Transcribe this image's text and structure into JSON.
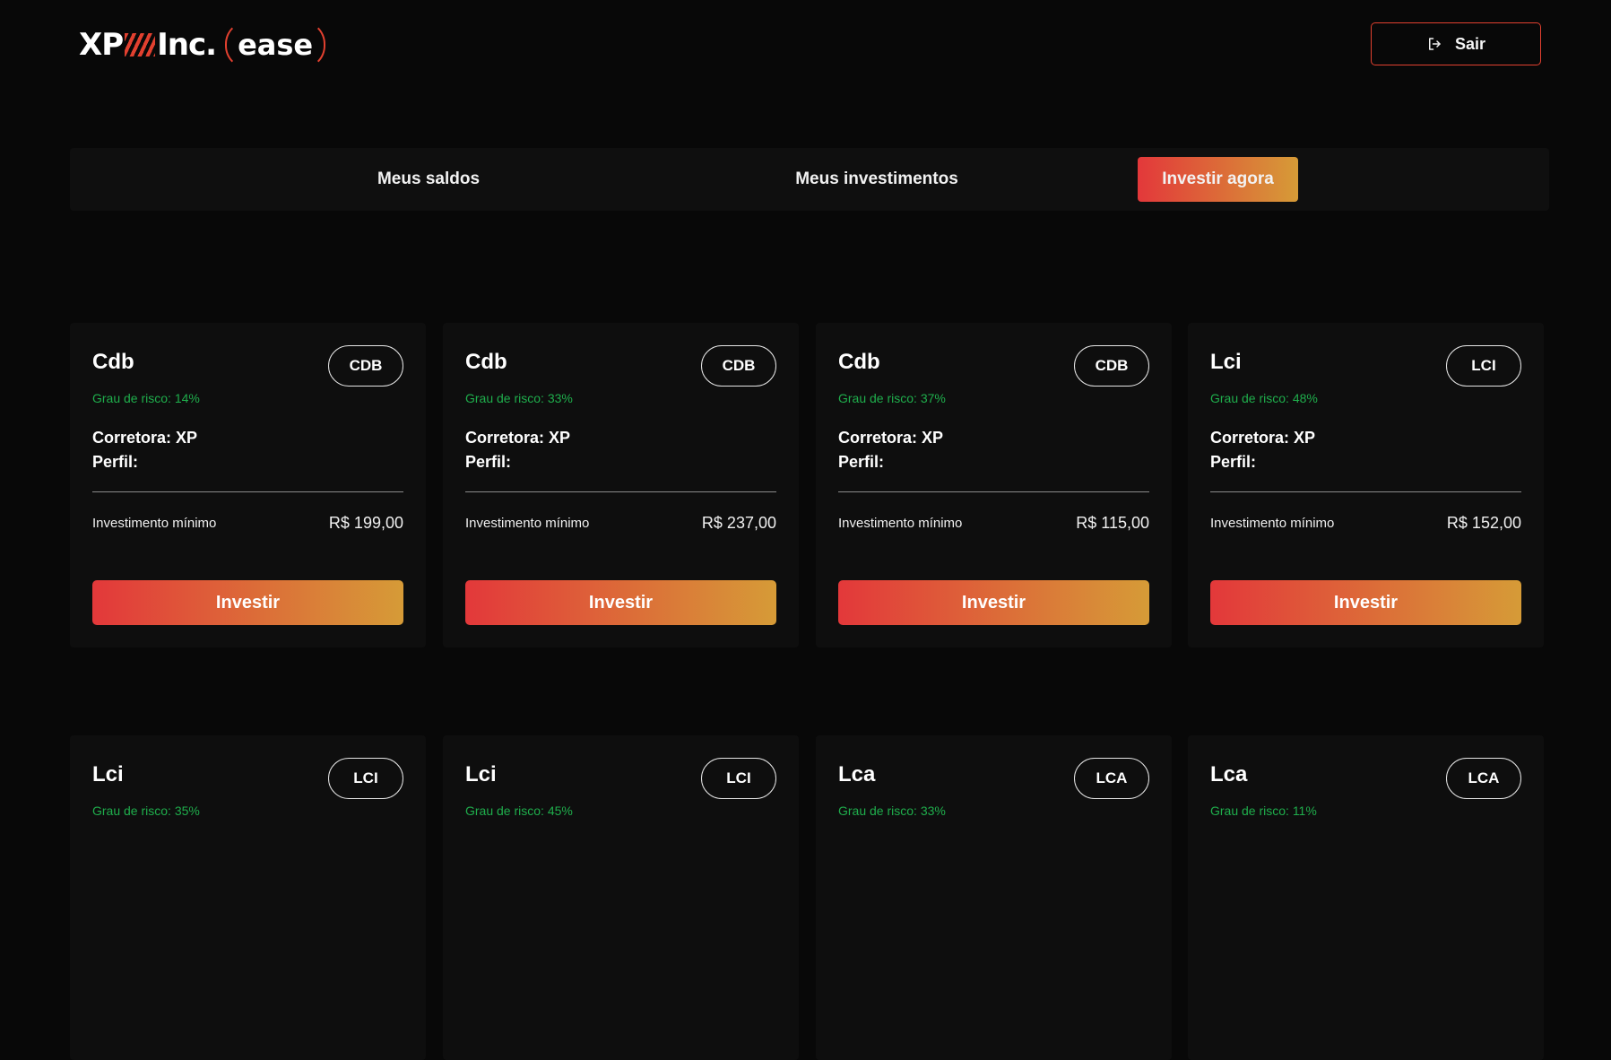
{
  "header": {
    "logo": {
      "xp": "XP",
      "inc": "Inc.",
      "ease": "ease"
    },
    "logout_label": "Sair"
  },
  "tabs": [
    {
      "label": "Meus saldos",
      "active": false
    },
    {
      "label": "Meus investimentos",
      "active": false
    },
    {
      "label": "Investir agora",
      "active": true
    }
  ],
  "cards": [
    {
      "title": "Cdb",
      "badge": "CDB",
      "risk": "Grau de risco: 14%",
      "broker": "Corretora: XP",
      "profile": "Perfil:",
      "min_label": "Investimento mínimo",
      "min_value": "R$ 199,00",
      "button": "Investir"
    },
    {
      "title": "Cdb",
      "badge": "CDB",
      "risk": "Grau de risco: 33%",
      "broker": "Corretora: XP",
      "profile": "Perfil:",
      "min_label": "Investimento mínimo",
      "min_value": "R$ 237,00",
      "button": "Investir"
    },
    {
      "title": "Cdb",
      "badge": "CDB",
      "risk": "Grau de risco: 37%",
      "broker": "Corretora: XP",
      "profile": "Perfil:",
      "min_label": "Investimento mínimo",
      "min_value": "R$ 115,00",
      "button": "Investir"
    },
    {
      "title": "Lci",
      "badge": "LCI",
      "risk": "Grau de risco: 48%",
      "broker": "Corretora: XP",
      "profile": "Perfil:",
      "min_label": "Investimento mínimo",
      "min_value": "R$ 152,00",
      "button": "Investir"
    },
    {
      "title": "Lci",
      "badge": "LCI",
      "risk": "Grau de risco: 35%"
    },
    {
      "title": "Lci",
      "badge": "LCI",
      "risk": "Grau de risco: 45%"
    },
    {
      "title": "Lca",
      "badge": "LCA",
      "risk": "Grau de risco: 33%"
    },
    {
      "title": "Lca",
      "badge": "LCA",
      "risk": "Grau de risco: 11%"
    }
  ],
  "colors": {
    "accent_start": "#e3383a",
    "accent_end": "#d69b37",
    "risk_text": "#1fae4c",
    "background": "#080808"
  }
}
